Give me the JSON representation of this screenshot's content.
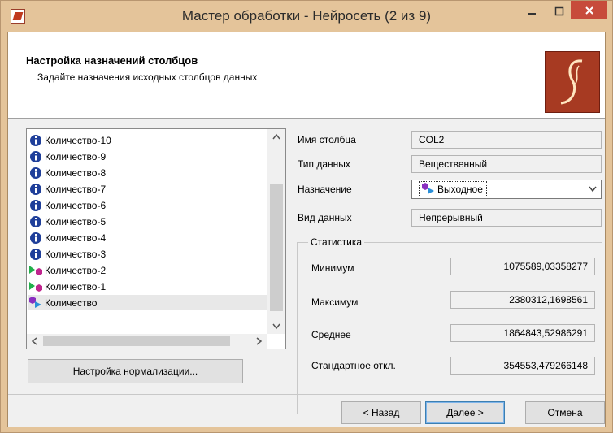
{
  "window": {
    "title": "Мастер обработки - Нейросеть (2 из 9)"
  },
  "header": {
    "title": "Настройка назначений столбцов",
    "subtitle": "Задайте назначения исходных столбцов данных"
  },
  "columns": [
    {
      "label": "Количество-10",
      "icon": "info-icon"
    },
    {
      "label": "Количество-9",
      "icon": "info-icon"
    },
    {
      "label": "Количество-8",
      "icon": "info-icon"
    },
    {
      "label": "Количество-7",
      "icon": "info-icon"
    },
    {
      "label": "Количество-6",
      "icon": "info-icon"
    },
    {
      "label": "Количество-5",
      "icon": "info-icon"
    },
    {
      "label": "Количество-4",
      "icon": "info-icon"
    },
    {
      "label": "Количество-3",
      "icon": "info-icon"
    },
    {
      "label": "Количество-2",
      "icon": "input-arrow-icon"
    },
    {
      "label": "Количество-1",
      "icon": "input-arrow-icon"
    },
    {
      "label": "Количество",
      "icon": "output-arrow-icon",
      "selected": true
    }
  ],
  "normalization_button": "Настройка нормализации...",
  "properties": {
    "column_name_label": "Имя столбца",
    "column_name": "COL2",
    "data_type_label": "Тип данных",
    "data_type": "Вещественный",
    "purpose_label": "Назначение",
    "purpose": "Выходное",
    "data_kind_label": "Вид данных",
    "data_kind": "Непрерывный"
  },
  "statistics": {
    "title": "Статистика",
    "min_label": "Минимум",
    "min": "1075589,03358277",
    "max_label": "Максимум",
    "max": "2380312,1698561",
    "mean_label": "Среднее",
    "mean": "1864843,52986291",
    "std_label": "Стандартное откл.",
    "std": "354553,479266148"
  },
  "buttons": {
    "back": "< Назад",
    "next": "Далее >",
    "cancel": "Отмена"
  },
  "colors": {
    "titlebar": "#e4c49a",
    "close": "#c74b3b",
    "info": "#1f3f9a",
    "logo": "#a73a22"
  }
}
